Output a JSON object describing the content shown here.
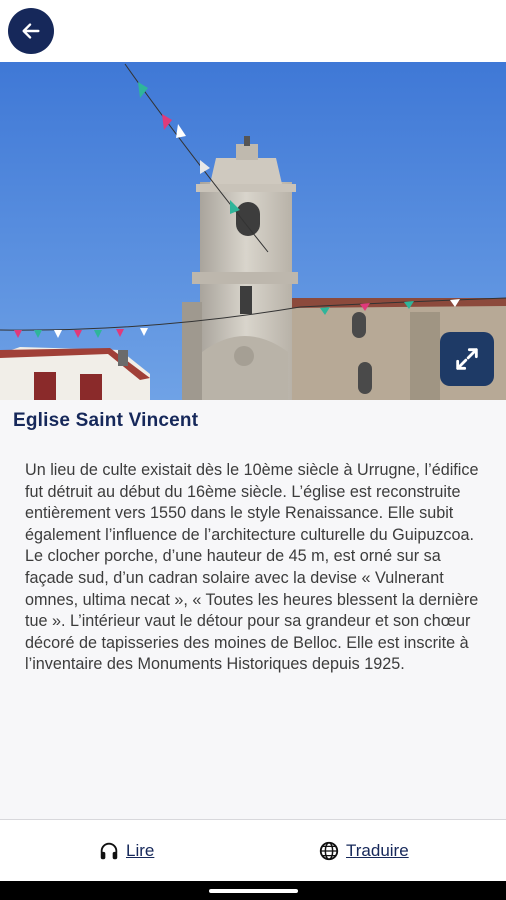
{
  "header": {
    "back_icon": "arrow-left-icon"
  },
  "hero": {
    "alt": "Eglise Saint Vincent photo",
    "expand_icon": "expand-arrows-icon"
  },
  "place": {
    "title": "Eglise Saint Vincent",
    "description": "Un lieu de culte existait dès le 10ème siècle à Urrugne, l’édifice fut détruit au début du 16ème siècle. L’église est reconstruite entièrement vers 1550 dans le style Renaissance. Elle subit également l’influence de l’architecture culturelle du Guipuzcoa. Le clocher porche, d’une hauteur de 45 m, est orné sur sa façade sud, d’un cadran solaire avec la devise « Vulnerant omnes, ultima necat », « Toutes les heures blessent la dernière tue ». L’intérieur vaut le détour pour sa grandeur et son chœur décoré de tapisseries des moines de Belloc. Elle est inscrite à l’inventaire des Monuments Historiques depuis 1925."
  },
  "actions": {
    "read_label": "Lire",
    "read_icon": "headphones-icon",
    "translate_label": "Traduire",
    "translate_icon": "globe-icon"
  },
  "colors": {
    "brand": "#16285a",
    "expand_button": "#1e3a66"
  }
}
